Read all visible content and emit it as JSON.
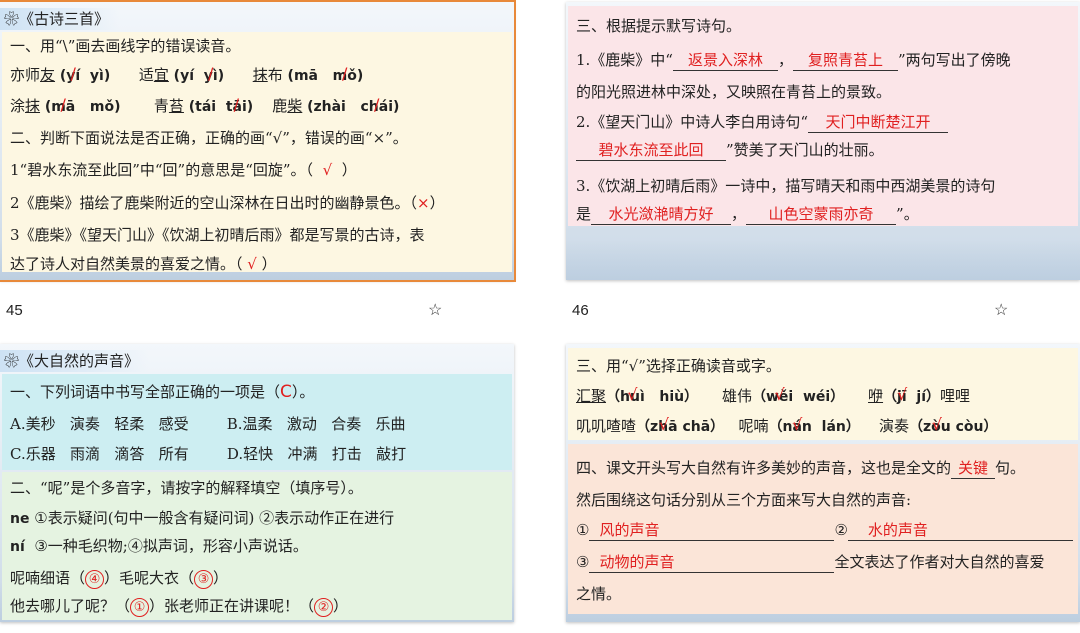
{
  "slides": [
    {
      "title": "《古诗三首》",
      "number": "45",
      "q1": "一、用“\\”画去画线字的错误读音。",
      "q1_items": [
        {
          "word_a": "亦师",
          "word_u": "亦",
          "word_b": "友",
          "py1": "yí",
          "py2": "yì"
        },
        {
          "word_a": "适",
          "word_u": "宜",
          "word_b": "",
          "py1": "yí",
          "py2": "yì"
        },
        {
          "word_a": "",
          "word_u": "抹",
          "word_b": "布",
          "py1": "mā",
          "py2": "mǒ"
        },
        {
          "word_a": "涂",
          "word_u": "抹",
          "word_b": "",
          "py1": "mā",
          "py2": "mǒ"
        },
        {
          "word_a": "青",
          "word_u": "苔",
          "word_b": "",
          "py1": "tái",
          "py2": "tāi"
        },
        {
          "word_a": "鹿",
          "word_u": "柴",
          "word_b": "",
          "py1": "zhài",
          "py2": "chái"
        }
      ],
      "q2": "二、判断下面说法是否正确，正确的画“√”，错误的画“×”。",
      "q2_1": "1“碧水东流至此回”中“回”的意思是“回旋”。（",
      "q2_1_ans": "√",
      "q2_2": "2《鹿柴》描绘了鹿柴附近的空山深林在日出时的幽静景色。（",
      "q2_2_ans": "×",
      "q2_3a": "3《鹿柴》《望天门山》《饮湖上初晴后雨》都是写景的古诗，表",
      "q2_3b": "达了诗人对自然美景的喜爱之情。（",
      "q2_3_ans": "√",
      "close_paren": "）"
    },
    {
      "number": "46",
      "q3": "三、根据提示默写诗句。",
      "l1a": "1.《鹿柴》中“",
      "a1": "返景入深林",
      "comma": "，",
      "a2": "复照青苔上",
      "l1b": "”两句写出了傍晚",
      "l2": "的阳光照进林中深处，又映照在青苔上的景致。",
      "l3a": "2.《望天门山》中诗人李白用诗句“",
      "a3": "天门中断楚江开",
      "a4": "碧水东流至此回",
      "l4b": "”赞美了天门山的壮丽。",
      "l5": "3.《饮湖上初晴后雨》一诗中，描写晴天和雨中西湖美景的诗句",
      "l6a": "是",
      "a5": "水光潋滟晴方好",
      "a6": "山色空蒙雨亦奇",
      "l6b": "”。"
    },
    {
      "title": "《大自然的声音》",
      "q1": "一、下列词语中书写全部正确的一项是（",
      "q1_ans": "C",
      "q1_end": "）。",
      "optA": [
        "A.美秒",
        "演奏",
        "轻柔",
        "感受"
      ],
      "optB": [
        "B.温柔",
        "激动",
        "合奏",
        "乐曲"
      ],
      "optC": [
        "C.乐器",
        "雨滴",
        "滴答",
        "所有"
      ],
      "optD": [
        "D.轻快",
        "冲满",
        "打击",
        "敲打"
      ],
      "q2": "二、“呢”是个多音字，请按字的解释填空（填序号）。",
      "ne": "ne",
      "ne_def": "①表示疑问(句中一般含有疑问词) ②表示动作正在进行",
      "ni": "ní",
      "ni_def": "③一种毛织物;④拟声词，形容小声说话。",
      "s1a": "呢喃细语（",
      "s1_ans": "④",
      "s1b": "）毛呢大衣（",
      "s1_ans2": "③",
      "s2a": "他去哪儿了呢？（",
      "s2_ans": "①",
      "s2b": "）张老师正在讲课呢！（",
      "s2_ans2": "②"
    },
    {
      "q3": "三、用“√”选择正确读音或字。",
      "r1": [
        {
          "w": "汇聚",
          "u": "汇",
          "p1": "huì",
          "p2": "hiù"
        },
        {
          "w": "雄伟",
          "u": "伟",
          "p1": "wěi",
          "p2": "wéi"
        },
        {
          "w": "咿",
          "u": "咿",
          "p1": "jī",
          "p2": "jí",
          "tail": "哩哩"
        }
      ],
      "r2": [
        {
          "w": "叽叽喳喳",
          "u": "喳喳",
          "p1": "zhā",
          "p2": "chā"
        },
        {
          "w": "呢喃",
          "u": "喃",
          "p1": "nán",
          "p2": "lán"
        },
        {
          "w": "演奏",
          "u": "奏",
          "p1": "zòu",
          "p2": "còu"
        }
      ],
      "q4a": "四、课文开头写大自然有许多美妙的声音，这也是全文的",
      "q4_ans": "关键",
      "q4b": "句。",
      "q4c": "然后围绕这句话分别从三个方面来写大自然的声音:",
      "c1": "①",
      "a1": "风的声音",
      "c2": "②",
      "a2": "水的声音",
      "c3": "③",
      "a3": "动物的声音",
      "q4d": "全文表达了作者对大自然的喜爱",
      "q4e": "之情。"
    }
  ],
  "colors": {
    "answer": "#e02020",
    "selected": "#e8893a"
  }
}
